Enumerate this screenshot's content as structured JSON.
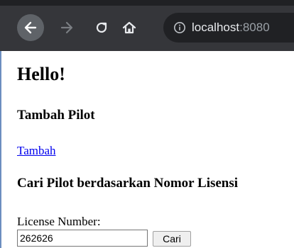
{
  "browser": {
    "url_host": "localhost",
    "url_port": ":8080",
    "icons": [
      "back-arrow-icon",
      "forward-arrow-icon",
      "reload-icon",
      "home-icon",
      "info-icon"
    ]
  },
  "page": {
    "heading": "Hello!",
    "add_section_title": "Tambah Pilot",
    "add_link": "Tambah",
    "search_section_title": "Cari Pilot berdasarkan Nomor Lisensi",
    "license_label": "License Number:",
    "license_value": "262626",
    "search_button": "Cari"
  },
  "colors": {
    "toolbar": "#35363a",
    "omnibox": "#202124",
    "link": "#0000ee"
  }
}
